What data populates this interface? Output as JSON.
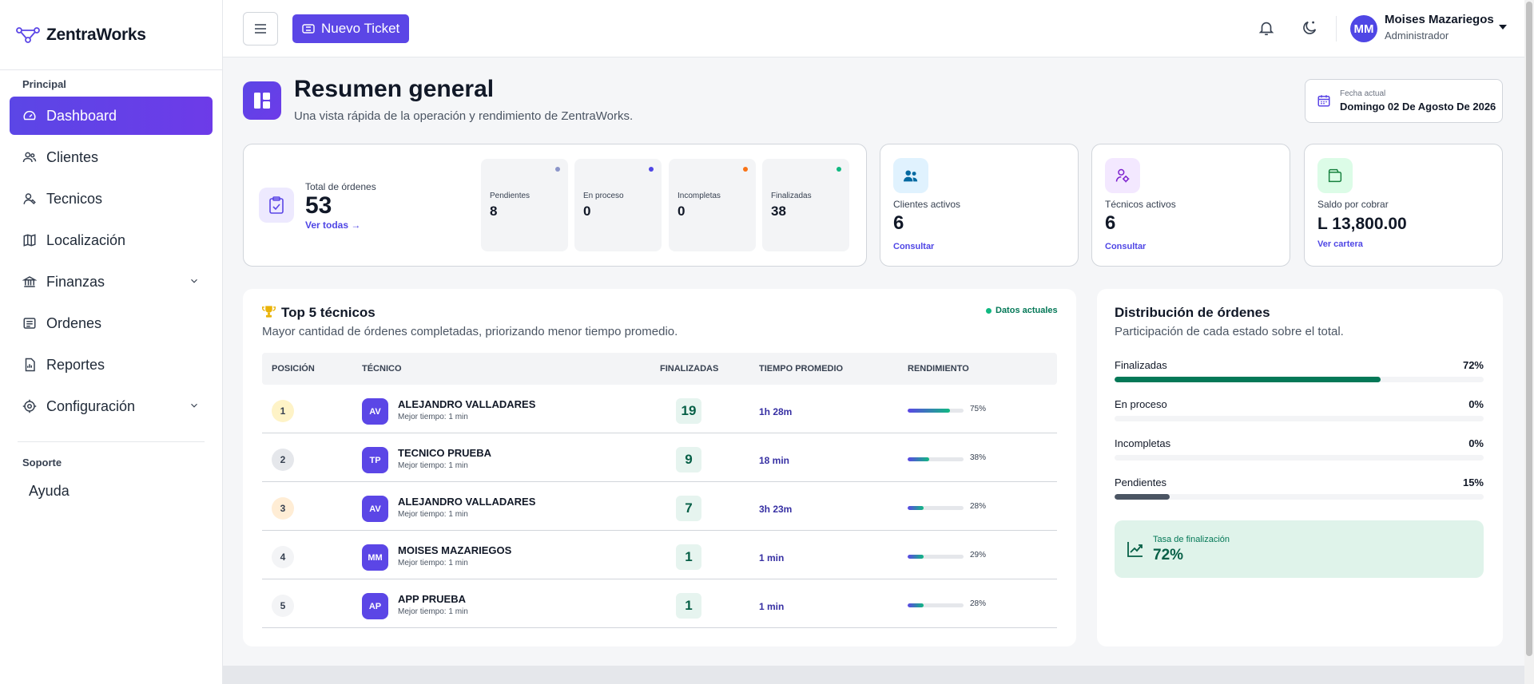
{
  "brand": {
    "name": "ZentraWorks"
  },
  "sidebar": {
    "section_main": "Principal",
    "items": [
      {
        "label": "Dashboard",
        "icon": "gauge-icon",
        "active": true
      },
      {
        "label": "Clientes",
        "icon": "users-icon"
      },
      {
        "label": "Tecnicos",
        "icon": "technician-icon"
      },
      {
        "label": "Localización",
        "icon": "map-icon"
      },
      {
        "label": "Finanzas",
        "icon": "bank-icon",
        "expandable": true
      },
      {
        "label": "Ordenes",
        "icon": "list-icon"
      },
      {
        "label": "Reportes",
        "icon": "report-icon"
      },
      {
        "label": "Configuración",
        "icon": "gear-icon",
        "expandable": true
      }
    ],
    "section_support": "Soporte",
    "help": "Ayuda"
  },
  "topbar": {
    "new_ticket": "Nuevo Ticket",
    "user": {
      "initials": "MM",
      "name": "Moises Mazariegos",
      "role": "Administrador"
    }
  },
  "header": {
    "title": "Resumen general",
    "subtitle": "Una vista rápida de la operación y rendimiento de ZentraWorks.",
    "date_label": "Fecha actual",
    "date_value": "Domingo 02 De Agosto De 2026"
  },
  "orders": {
    "label": "Total de órdenes",
    "total": "53",
    "link": "Ver todas →",
    "statuses": [
      {
        "label": "Pendientes",
        "value": "8",
        "color": "#8b95c9"
      },
      {
        "label": "En proceso",
        "value": "0",
        "color": "#4f46e5"
      },
      {
        "label": "Incompletas",
        "value": "0",
        "color": "#f97316"
      },
      {
        "label": "Finalizadas",
        "value": "38",
        "color": "#10b981"
      }
    ]
  },
  "stats": [
    {
      "label": "Clientes activos",
      "value": "6",
      "link": "Consultar",
      "icon": "users-icon",
      "icon_bg": "#e0f2fe",
      "icon_color": "#0369a1"
    },
    {
      "label": "Técnicos activos",
      "value": "6",
      "link": "Consultar",
      "icon": "user-gear-icon",
      "icon_bg": "#f3e8ff",
      "icon_color": "#7e22ce"
    },
    {
      "label": "Saldo por cobrar",
      "value": "L 13,800.00",
      "link": "Ver cartera",
      "icon": "wallet-icon",
      "icon_bg": "#dcfce7",
      "icon_color": "#15803d"
    }
  ],
  "top_techs": {
    "title": "Top 5 técnicos",
    "subtitle": "Mayor cantidad de órdenes completadas, priorizando menor tiempo promedio.",
    "badge": "Datos actuales",
    "columns": [
      "Posición",
      "Técnico",
      "Finalizadas",
      "Tiempo promedio",
      "Rendimiento"
    ],
    "rows": [
      {
        "rank": "1",
        "rank_bg": "#fef3c7",
        "initials": "AV",
        "name": "ALEJANDRO VALLADARES",
        "best": "Mejor tiempo: 1 min",
        "finished": "19",
        "avg": "1h 28m",
        "perf": 75,
        "perf_label": "75%"
      },
      {
        "rank": "2",
        "rank_bg": "#e5e7eb",
        "initials": "TP",
        "name": "TECNICO PRUEBA",
        "best": "Mejor tiempo: 1 min",
        "finished": "9",
        "avg": "18 min",
        "perf": 38,
        "perf_label": "38%"
      },
      {
        "rank": "3",
        "rank_bg": "#ffedd5",
        "initials": "AV",
        "name": "ALEJANDRO VALLADARES",
        "best": "Mejor tiempo: 1 min",
        "finished": "7",
        "avg": "3h 23m",
        "perf": 28,
        "perf_label": "28%"
      },
      {
        "rank": "4",
        "rank_bg": "#f3f4f6",
        "initials": "MM",
        "name": "MOISES MAZARIEGOS",
        "best": "Mejor tiempo: 1 min",
        "finished": "1",
        "avg": "1 min",
        "perf": 29,
        "perf_label": "29%"
      },
      {
        "rank": "5",
        "rank_bg": "#f3f4f6",
        "initials": "AP",
        "name": "APP PRUEBA",
        "best": "Mejor tiempo: 1 min",
        "finished": "1",
        "avg": "1 min",
        "perf": 28,
        "perf_label": "28%"
      }
    ]
  },
  "distribution": {
    "title": "Distribución de órdenes",
    "subtitle": "Participación de cada estado sobre el total.",
    "items": [
      {
        "label": "Finalizadas",
        "pct_label": "72%",
        "pct": 72,
        "color": "#047857"
      },
      {
        "label": "En proceso",
        "pct_label": "0%",
        "pct": 0,
        "color": "#4f46e5"
      },
      {
        "label": "Incompletas",
        "pct_label": "0%",
        "pct": 0,
        "color": "#f97316"
      },
      {
        "label": "Pendientes",
        "pct_label": "15%",
        "pct": 15,
        "color": "#4b5563"
      }
    ],
    "rate_label": "Tasa de finalización",
    "rate_value": "72%"
  }
}
